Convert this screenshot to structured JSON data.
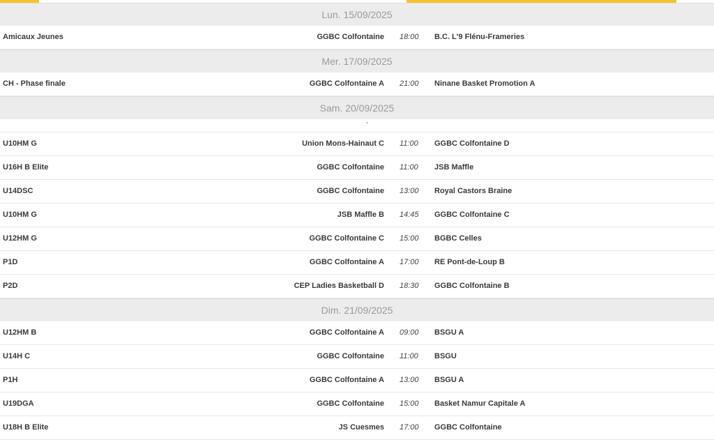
{
  "days": [
    {
      "date": "Lun. 15/09/2025",
      "matches": [
        {
          "category": "Amicaux Jeunes",
          "home": "GGBC Colfontaine",
          "time": "18:00",
          "away": "B.C. L'9 Flénu-Frameries"
        }
      ]
    },
    {
      "date": "Mer. 17/09/2025",
      "matches": [
        {
          "category": "CH - Phase finale",
          "home": "GGBC Colfontaine A",
          "time": "21:00",
          "away": "Ninane Basket Promotion A"
        }
      ]
    },
    {
      "date": "Sam. 20/09/2025",
      "separator": "-",
      "matches": [
        {
          "category": "U10HM G",
          "home": "Union Mons-Hainaut C",
          "time": "11:00",
          "away": "GGBC Colfontaine D"
        },
        {
          "category": "U16H B Elite",
          "home": "GGBC Colfontaine",
          "time": "11:00",
          "away": "JSB Maffle"
        },
        {
          "category": "U14DSC",
          "home": "GGBC Colfontaine",
          "time": "13:00",
          "away": "Royal Castors Braine"
        },
        {
          "category": "U10HM G",
          "home": "JSB Maffle B",
          "time": "14:45",
          "away": "GGBC Colfontaine C"
        },
        {
          "category": "U12HM G",
          "home": "GGBC Colfontaine C",
          "time": "15:00",
          "away": "BGBC Celles"
        },
        {
          "category": "P1D",
          "home": "GGBC Colfontaine A",
          "time": "17:00",
          "away": "RE Pont-de-Loup B"
        },
        {
          "category": "P2D",
          "home": "CEP Ladies Basketball D",
          "time": "18:30",
          "away": "GGBC Colfontaine B"
        }
      ]
    },
    {
      "date": "Dim. 21/09/2025",
      "matches": [
        {
          "category": "U12HM B",
          "home": "GGBC Colfontaine A",
          "time": "09:00",
          "away": "BSGU A"
        },
        {
          "category": "U14H C",
          "home": "GGBC Colfontaine",
          "time": "11:00",
          "away": "BSGU"
        },
        {
          "category": "P1H",
          "home": "GGBC Colfontaine A",
          "time": "13:00",
          "away": "BSGU A"
        },
        {
          "category": "U19DGA",
          "home": "GGBC Colfontaine",
          "time": "15:00",
          "away": "Basket Namur Capitale A"
        },
        {
          "category": "U18H B Elite",
          "home": "JS Cuesmes",
          "time": "17:00",
          "away": "GGBC Colfontaine"
        }
      ]
    }
  ],
  "colors": {
    "accent": "#f5c32c",
    "header_bg": "#ececec",
    "header_text": "#9a9a9a"
  }
}
